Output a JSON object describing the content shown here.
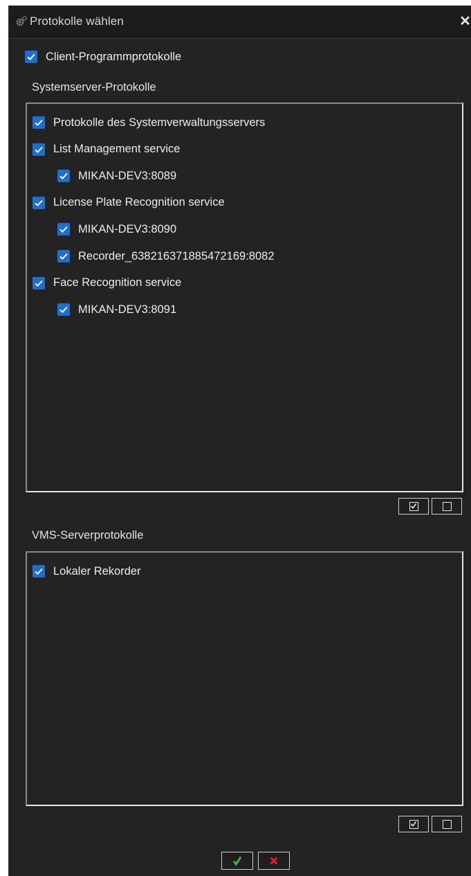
{
  "window": {
    "title": "Protokolle wählen",
    "close_glyph": "✕"
  },
  "client": {
    "label": "Client-Programmprotokolle",
    "checked": true
  },
  "system_servers": {
    "section_label": "Systemserver-Protokolle",
    "items": [
      {
        "label": "Protokolle des Systemverwaltungsservers",
        "level": 0,
        "checked": true
      },
      {
        "label": "List Management service",
        "level": 0,
        "checked": true
      },
      {
        "label": "MIKAN-DEV3:8089",
        "level": 1,
        "checked": true
      },
      {
        "label": "License Plate Recognition service",
        "level": 0,
        "checked": true
      },
      {
        "label": "MIKAN-DEV3:8090",
        "level": 1,
        "checked": true
      },
      {
        "label": "Recorder_638216371885472169:8082",
        "level": 1,
        "checked": true
      },
      {
        "label": "Face Recognition service",
        "level": 0,
        "checked": true
      },
      {
        "label": "MIKAN-DEV3:8091",
        "level": 1,
        "checked": true
      }
    ]
  },
  "vms_servers": {
    "section_label": "VMS-Serverprotokolle",
    "items": [
      {
        "label": "Lokaler Rekorder",
        "level": 0,
        "checked": true
      }
    ]
  },
  "icons": {
    "app": "gear-icon",
    "select_all": "check-all-icon",
    "select_none": "uncheck-all-icon",
    "ok": "checkmark-icon",
    "cancel": "x-icon"
  },
  "colors": {
    "background": "#232323",
    "checkbox": "#1e6fd0",
    "ok_icon": "#3bb83b",
    "cancel_icon": "#e02020"
  }
}
